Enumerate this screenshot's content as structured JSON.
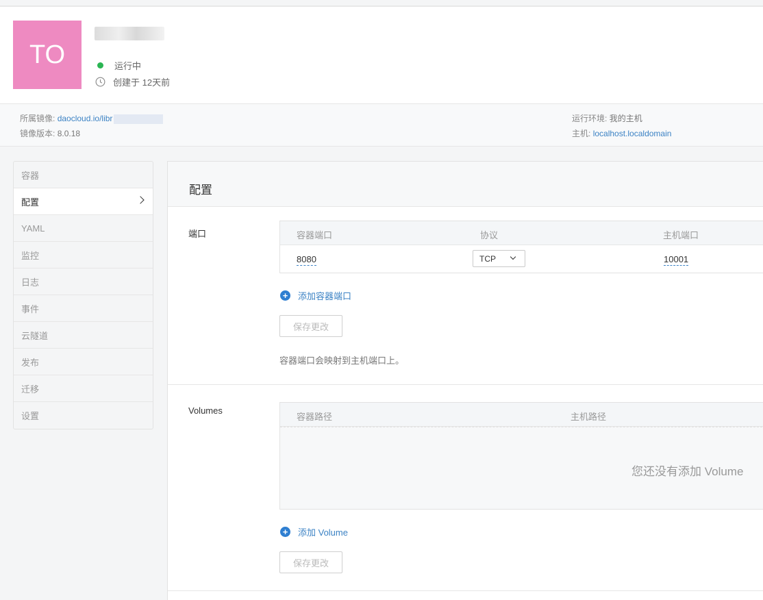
{
  "header": {
    "avatar_initials": "TO",
    "status": "运行中",
    "created": "创建于 12天前",
    "status_color": "#2bb553",
    "avatar_color": "#ee8ac1"
  },
  "info": {
    "image_label": "所属镜像:",
    "image_value": "daocloud.io/libr",
    "version_label": "镜像版本:",
    "version_value": "8.0.18",
    "env_label": "运行环境:",
    "env_value": "我的主机",
    "host_label": "主机:",
    "host_value": "localhost.localdomain"
  },
  "sidebar": {
    "items": [
      {
        "label": "容器"
      },
      {
        "label": "配置"
      },
      {
        "label": "YAML"
      },
      {
        "label": "监控"
      },
      {
        "label": "日志"
      },
      {
        "label": "事件"
      },
      {
        "label": "云隧道"
      },
      {
        "label": "发布"
      },
      {
        "label": "迁移"
      },
      {
        "label": "设置"
      }
    ],
    "active_index": 1
  },
  "panel": {
    "title": "配置",
    "ports": {
      "label": "端口",
      "headers": [
        "容器端口",
        "协议",
        "主机端口"
      ],
      "rows": [
        {
          "container_port": "8080",
          "protocol": "TCP",
          "host_port": "10001"
        }
      ],
      "add_label": "添加容器端口",
      "save_label": "保存更改",
      "hint": "容器端口会映射到主机端口上。"
    },
    "volumes": {
      "label": "Volumes",
      "headers": [
        "容器路径",
        "主机路径"
      ],
      "empty_text": "您还没有添加 Volume",
      "add_label": "添加 Volume",
      "save_label": "保存更改"
    }
  },
  "colors": {
    "link": "#3b82c4",
    "accent": "#2f7fd1"
  }
}
